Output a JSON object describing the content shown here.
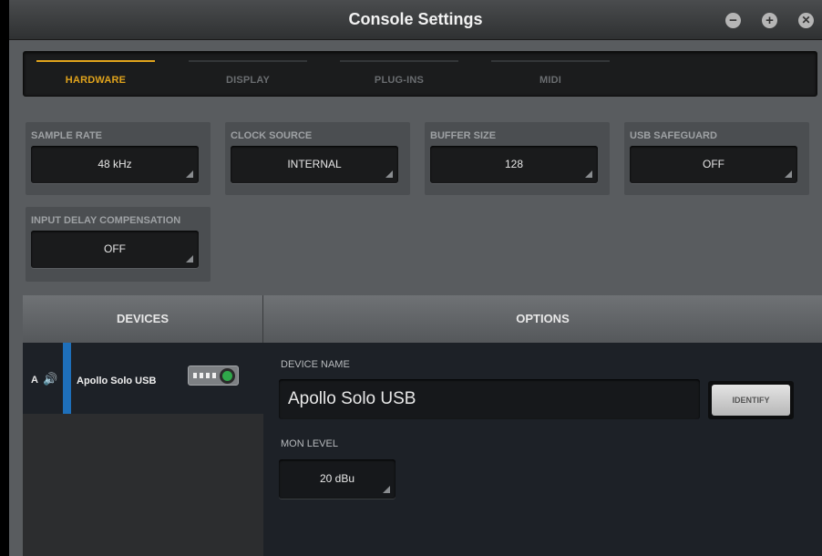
{
  "window": {
    "title": "Console Settings",
    "controls": {
      "minimize": "−",
      "maximize": "+",
      "close": "✕"
    }
  },
  "tabs": [
    {
      "label": "HARDWARE",
      "active": true
    },
    {
      "label": "DISPLAY",
      "active": false
    },
    {
      "label": "PLUG-INS",
      "active": false
    },
    {
      "label": "MIDI",
      "active": false
    }
  ],
  "settings": {
    "sample_rate": {
      "label": "SAMPLE RATE",
      "value": "48 kHz"
    },
    "clock_source": {
      "label": "CLOCK SOURCE",
      "value": "INTERNAL"
    },
    "buffer_size": {
      "label": "BUFFER SIZE",
      "value": "128"
    },
    "usb_safeguard": {
      "label": "USB SAFEGUARD",
      "value": "OFF"
    },
    "input_delay_compensation": {
      "label": "INPUT DELAY COMPENSATION",
      "value": "OFF"
    }
  },
  "devices": {
    "header": "DEVICES",
    "items": [
      {
        "letter": "A",
        "speaker_icon": "speaker-icon",
        "name": "Apollo Solo USB",
        "selected": true
      }
    ]
  },
  "options": {
    "header": "OPTIONS",
    "device_name_label": "DEVICE NAME",
    "device_name_value": "Apollo Solo USB",
    "identify_label": "IDENTIFY",
    "mon_level_label": "MON LEVEL",
    "mon_level_value": "20 dBu"
  },
  "colors": {
    "accent": "#e0a31c",
    "selection": "#1e6fba",
    "device_led": "#2fa84a"
  }
}
